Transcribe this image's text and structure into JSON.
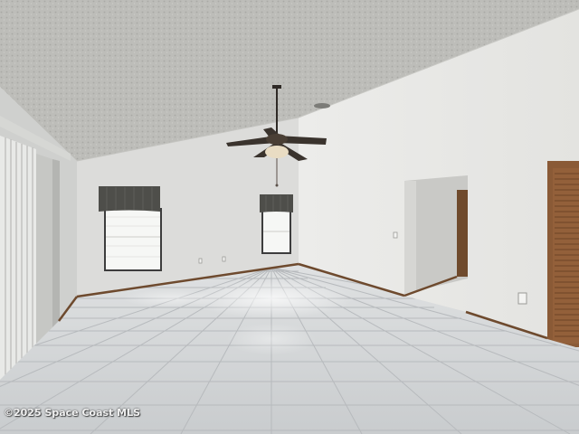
{
  "photo": {
    "watermark": "©2025 Space Coast MLS"
  }
}
